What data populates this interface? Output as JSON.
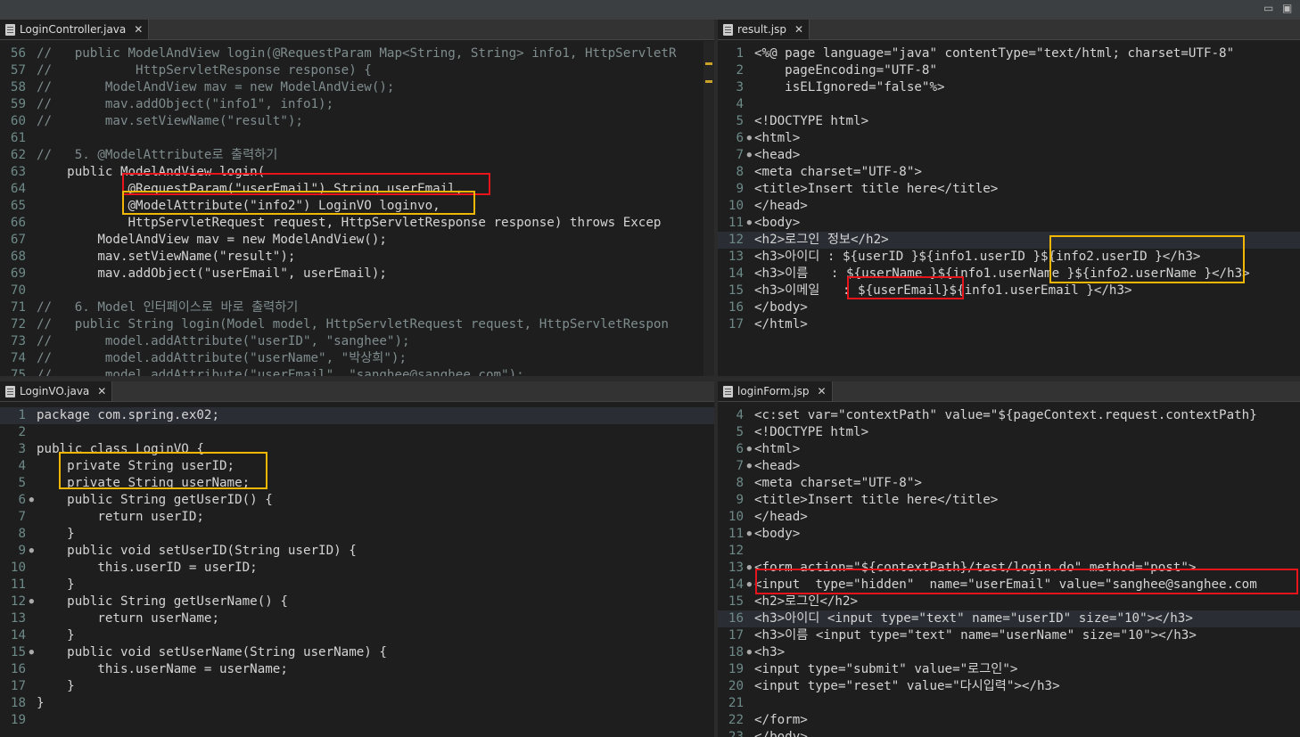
{
  "window": {
    "minimize_glyph": "▭",
    "maximize_glyph": "▣"
  },
  "panes": [
    {
      "id": "login-controller",
      "tab": "LoginController.java",
      "lines": [
        {
          "n": "56",
          "t": "//   public ModelAndView login(@RequestParam Map<String, String> info1, HttpServletR"
        },
        {
          "n": "57",
          "t": "//           HttpServletResponse response) {"
        },
        {
          "n": "58",
          "t": "//       ModelAndView mav = new ModelAndView();"
        },
        {
          "n": "59",
          "t": "//       mav.addObject(\"info1\", info1);"
        },
        {
          "n": "60",
          "t": "//       mav.setViewName(\"result\");"
        },
        {
          "n": "61",
          "t": ""
        },
        {
          "n": "62",
          "t": "//   5. @ModelAttribute로 출력하기"
        },
        {
          "n": "63",
          "t": "    public ModelAndView login("
        },
        {
          "n": "64",
          "t": "            @RequestParam(\"userEmail\") String userEmail,"
        },
        {
          "n": "65",
          "t": "            @ModelAttribute(\"info2\") LoginVO loginvo,"
        },
        {
          "n": "66",
          "t": "            HttpServletRequest request, HttpServletResponse response) throws Excep"
        },
        {
          "n": "67",
          "t": "        ModelAndView mav = new ModelAndView();"
        },
        {
          "n": "68",
          "t": "        mav.setViewName(\"result\");"
        },
        {
          "n": "69",
          "t": "        mav.addObject(\"userEmail\", userEmail);"
        },
        {
          "n": "70",
          "t": ""
        },
        {
          "n": "71",
          "t": "//   6. Model 인터페이스로 바로 출력하기"
        },
        {
          "n": "72",
          "t": "//   public String login(Model model, HttpServletRequest request, HttpServletRespon"
        },
        {
          "n": "73",
          "t": "//       model.addAttribute(\"userID\", \"sanghee\");"
        },
        {
          "n": "74",
          "t": "//       model.addAttribute(\"userName\", \"박상희\");"
        },
        {
          "n": "75",
          "t": "//       model.addAttribute(\"userEmail\", \"sanghee@sanghee.com\");"
        }
      ]
    },
    {
      "id": "result-jsp",
      "tab": "result.jsp",
      "lines": [
        {
          "n": "1",
          "t": "<%@ page language=\"java\" contentType=\"text/html; charset=UTF-8\""
        },
        {
          "n": "2",
          "t": "    pageEncoding=\"UTF-8\""
        },
        {
          "n": "3",
          "t": "    isELIgnored=\"false\"%>"
        },
        {
          "n": "4",
          "t": ""
        },
        {
          "n": "5",
          "t": "<!DOCTYPE html>"
        },
        {
          "n": "6",
          "t": "<html>"
        },
        {
          "n": "7",
          "t": "<head>"
        },
        {
          "n": "8",
          "t": "<meta charset=\"UTF-8\">"
        },
        {
          "n": "9",
          "t": "<title>Insert title here</title>"
        },
        {
          "n": "10",
          "t": "</head>"
        },
        {
          "n": "11",
          "t": "<body>"
        },
        {
          "n": "12",
          "t": "<h2>로그인 정보</h2>"
        },
        {
          "n": "13",
          "t": "<h3>아이디 : ${userID }${info1.userID }${info2.userID }</h3>"
        },
        {
          "n": "14",
          "t": "<h3>이름   : ${userName }${info1.userName }${info2.userName }</h3>"
        },
        {
          "n": "15",
          "t": "<h3>이메일   : ${userEmail}${info1.userEmail }</h3>"
        },
        {
          "n": "16",
          "t": "</body>"
        },
        {
          "n": "17",
          "t": "</html>"
        }
      ]
    },
    {
      "id": "login-vo",
      "tab": "LoginVO.java",
      "lines": [
        {
          "n": "1",
          "t": "package com.spring.ex02;"
        },
        {
          "n": "2",
          "t": ""
        },
        {
          "n": "3",
          "t": "public class LoginVO {"
        },
        {
          "n": "4",
          "t": "    private String userID;"
        },
        {
          "n": "5",
          "t": "    private String userName;"
        },
        {
          "n": "6",
          "t": "    public String getUserID() {"
        },
        {
          "n": "7",
          "t": "        return userID;"
        },
        {
          "n": "8",
          "t": "    }"
        },
        {
          "n": "9",
          "t": "    public void setUserID(String userID) {"
        },
        {
          "n": "10",
          "t": "        this.userID = userID;"
        },
        {
          "n": "11",
          "t": "    }"
        },
        {
          "n": "12",
          "t": "    public String getUserName() {"
        },
        {
          "n": "13",
          "t": "        return userName;"
        },
        {
          "n": "14",
          "t": "    }"
        },
        {
          "n": "15",
          "t": "    public void setUserName(String userName) {"
        },
        {
          "n": "16",
          "t": "        this.userName = userName;"
        },
        {
          "n": "17",
          "t": "    }"
        },
        {
          "n": "18",
          "t": "}"
        },
        {
          "n": "19",
          "t": ""
        }
      ]
    },
    {
      "id": "login-form-jsp",
      "tab": "loginForm.jsp",
      "lines": [
        {
          "n": "4",
          "t": "<c:set var=\"contextPath\" value=\"${pageContext.request.contextPath}"
        },
        {
          "n": "5",
          "t": "<!DOCTYPE html>"
        },
        {
          "n": "6",
          "t": "<html>"
        },
        {
          "n": "7",
          "t": "<head>"
        },
        {
          "n": "8",
          "t": "<meta charset=\"UTF-8\">"
        },
        {
          "n": "9",
          "t": "<title>Insert title here</title>"
        },
        {
          "n": "10",
          "t": "</head>"
        },
        {
          "n": "11",
          "t": "<body>"
        },
        {
          "n": "12",
          "t": ""
        },
        {
          "n": "13",
          "t": "<form action=\"${contextPath}/test/login.do\" method=\"post\">"
        },
        {
          "n": "14",
          "t": "<input  type=\"hidden\"  name=\"userEmail\" value=\"sanghee@sanghee.com"
        },
        {
          "n": "15",
          "t": "<h2>로그인</h2>"
        },
        {
          "n": "16",
          "t": "<h3>아이디 <input type=\"text\" name=\"userID\" size=\"10\"></h3>"
        },
        {
          "n": "17",
          "t": "<h3>이름 <input type=\"text\" name=\"userName\" size=\"10\"></h3>"
        },
        {
          "n": "18",
          "t": "<h3>"
        },
        {
          "n": "19",
          "t": "<input type=\"submit\" value=\"로그인\">"
        },
        {
          "n": "20",
          "t": "<input type=\"reset\" value=\"다시입력\"></h3>"
        },
        {
          "n": "21",
          "t": ""
        },
        {
          "n": "22",
          "t": "</form>"
        },
        {
          "n": "23",
          "t": "</body>"
        }
      ]
    }
  ]
}
